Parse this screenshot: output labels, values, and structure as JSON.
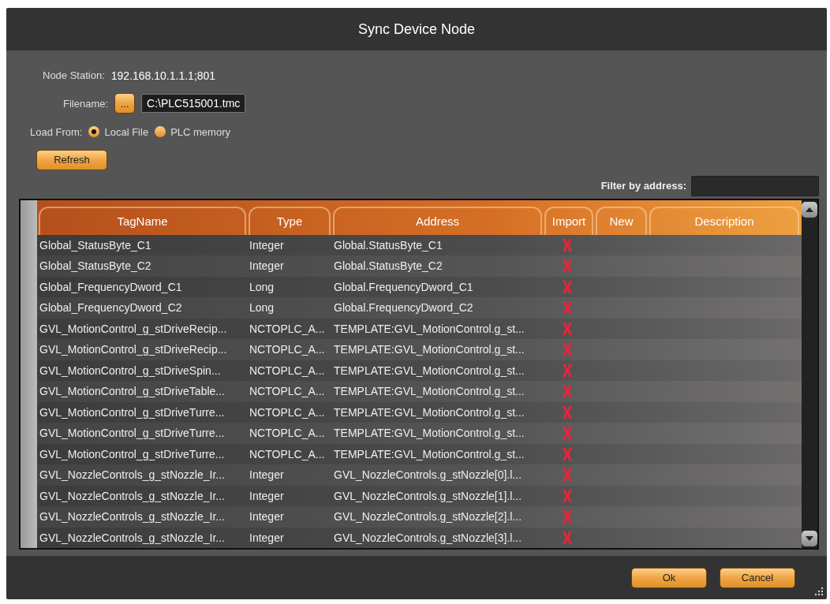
{
  "window": {
    "title": "Sync Device Node"
  },
  "node_station": {
    "label": "Node Station:",
    "value": "192.168.10.1.1.1;801"
  },
  "filename": {
    "label": "Filename:",
    "browse": "...",
    "value": "C:\\PLC515001.tmc"
  },
  "load_from": {
    "label": "Load From:",
    "options": [
      {
        "label": "Local File",
        "selected": true
      },
      {
        "label": "PLC memory",
        "selected": false
      }
    ]
  },
  "refresh_button": "Refresh",
  "filter": {
    "label": "Filter by address:"
  },
  "table": {
    "columns": [
      "TagName",
      "Type",
      "Address",
      "Import",
      "New",
      "Description"
    ],
    "rows": [
      {
        "tag": "Global_StatusByte_C1",
        "type": "Integer",
        "address": "Global.StatusByte_C1",
        "import": false
      },
      {
        "tag": "Global_StatusByte_C2",
        "type": "Integer",
        "address": "Global.StatusByte_C2",
        "import": false
      },
      {
        "tag": "Global_FrequencyDword_C1",
        "type": "Long",
        "address": "Global.FrequencyDword_C1",
        "import": false
      },
      {
        "tag": "Global_FrequencyDword_C2",
        "type": "Long",
        "address": "Global.FrequencyDword_C2",
        "import": false
      },
      {
        "tag": "GVL_MotionControl_g_stDriveRecip...",
        "type": "NCTOPLC_A...",
        "address": "TEMPLATE:GVL_MotionControl.g_st...",
        "import": false
      },
      {
        "tag": "GVL_MotionControl_g_stDriveRecip...",
        "type": "NCTOPLC_A...",
        "address": "TEMPLATE:GVL_MotionControl.g_st...",
        "import": false
      },
      {
        "tag": "GVL_MotionControl_g_stDriveSpin...",
        "type": "NCTOPLC_A...",
        "address": "TEMPLATE:GVL_MotionControl.g_st...",
        "import": false
      },
      {
        "tag": "GVL_MotionControl_g_stDriveTable...",
        "type": "NCTOPLC_A...",
        "address": "TEMPLATE:GVL_MotionControl.g_st...",
        "import": false
      },
      {
        "tag": "GVL_MotionControl_g_stDriveTurre...",
        "type": "NCTOPLC_A...",
        "address": "TEMPLATE:GVL_MotionControl.g_st...",
        "import": false
      },
      {
        "tag": "GVL_MotionControl_g_stDriveTurre...",
        "type": "NCTOPLC_A...",
        "address": "TEMPLATE:GVL_MotionControl.g_st...",
        "import": false
      },
      {
        "tag": "GVL_MotionControl_g_stDriveTurre...",
        "type": "NCTOPLC_A...",
        "address": "TEMPLATE:GVL_MotionControl.g_st...",
        "import": false
      },
      {
        "tag": "GVL_NozzleControls_g_stNozzle_Ir...",
        "type": "Integer",
        "address": "GVL_NozzleControls.g_stNozzle[0].l...",
        "import": false
      },
      {
        "tag": "GVL_NozzleControls_g_stNozzle_Ir...",
        "type": "Integer",
        "address": "GVL_NozzleControls.g_stNozzle[1].l...",
        "import": false
      },
      {
        "tag": "GVL_NozzleControls_g_stNozzle_Ir...",
        "type": "Integer",
        "address": "GVL_NozzleControls.g_stNozzle[2].l...",
        "import": false
      },
      {
        "tag": "GVL_NozzleControls_g_stNozzle_Ir...",
        "type": "Integer",
        "address": "GVL_NozzleControls.g_stNozzle[3].l...",
        "import": false
      }
    ]
  },
  "buttons": [
    "Ok",
    "Cancel"
  ]
}
